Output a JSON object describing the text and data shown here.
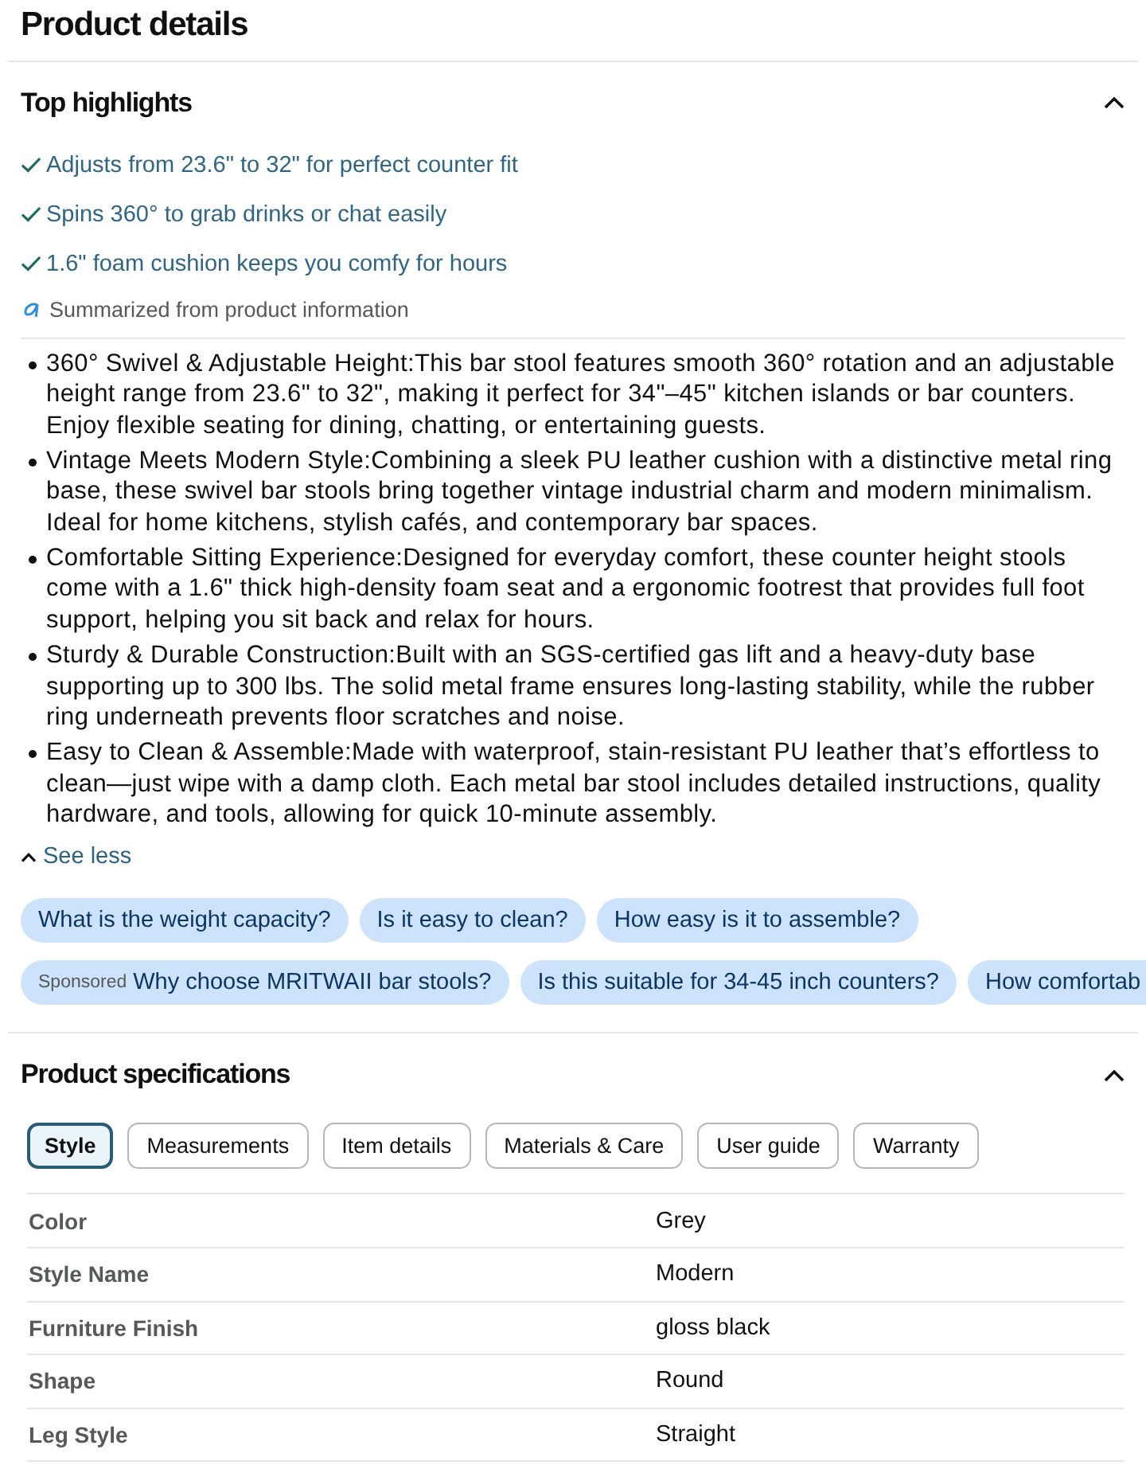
{
  "page_title": "Product details",
  "top_highlights": {
    "title": "Top highlights",
    "expanded": true,
    "highlights": [
      "Adjusts from 23.6\" to 32\" for perfect counter fit",
      "Spins 360° to grab drinks or chat easily",
      "1.6\" foam cushion keeps you comfy for hours"
    ],
    "summary_note": "Summarized from product information",
    "bullets": [
      "360° Swivel & Adjustable Height:This bar stool features smooth 360° rotation and an adjustable height range from 23.6\" to 32\", making it perfect for 34\"–45\" kitchen islands or bar counters. Enjoy flexible seating for dining, chatting, or entertaining guests.",
      "Vintage Meets Modern Style:Combining a sleek PU leather cushion with a distinctive metal ring base, these swivel bar stools bring together vintage industrial charm and modern minimalism. Ideal for home kitchens, stylish cafés, and contemporary bar spaces.",
      "Comfortable Sitting Experience:Designed for everyday comfort, these counter height stools come with a 1.6\" thick high-density foam seat and a ergonomic footrest that provides full foot support, helping you sit back and relax for hours.",
      "Sturdy & Durable Construction:Built with an SGS-certified gas lift and a heavy-duty base supporting up to 300 lbs. The solid metal frame ensures long-lasting stability, while the rubber ring underneath prevents floor scratches and noise.",
      "Easy to Clean & Assemble:Made with waterproof, stain-resistant PU leather that’s effortless to clean—just wipe with a damp cloth. Each metal bar stool includes detailed instructions, quality hardware, and tools, allowing for quick 10-minute assembly."
    ],
    "see_less": "See less",
    "question_rows": [
      [
        {
          "text": "What is the weight capacity?",
          "clipped": false
        },
        {
          "text": "Is it easy to clean?",
          "clipped": false
        },
        {
          "text": "How easy is it to assemble?",
          "clipped": false
        }
      ],
      [
        {
          "label": "Sponsored",
          "text": "Why choose MRITWAII bar stools?",
          "clipped": false
        },
        {
          "text": "Is this suitable for 34-45 inch counters?",
          "clipped": false
        },
        {
          "text": "How comfortab",
          "clipped": true
        }
      ]
    ]
  },
  "product_specifications": {
    "title": "Product specifications",
    "expanded": true,
    "tabs": [
      {
        "label": "Style",
        "selected": true
      },
      {
        "label": "Measurements",
        "selected": false
      },
      {
        "label": "Item details",
        "selected": false
      },
      {
        "label": "Materials & Care",
        "selected": false
      },
      {
        "label": "User guide",
        "selected": false
      },
      {
        "label": "Warranty",
        "selected": false
      }
    ],
    "rows": [
      {
        "name": "Color",
        "value": "Grey"
      },
      {
        "name": "Style Name",
        "value": "Modern"
      },
      {
        "name": "Furniture Finish",
        "value": "gloss black"
      },
      {
        "name": "Shape",
        "value": "Round"
      },
      {
        "name": "Leg Style",
        "value": "Straight"
      }
    ]
  }
}
